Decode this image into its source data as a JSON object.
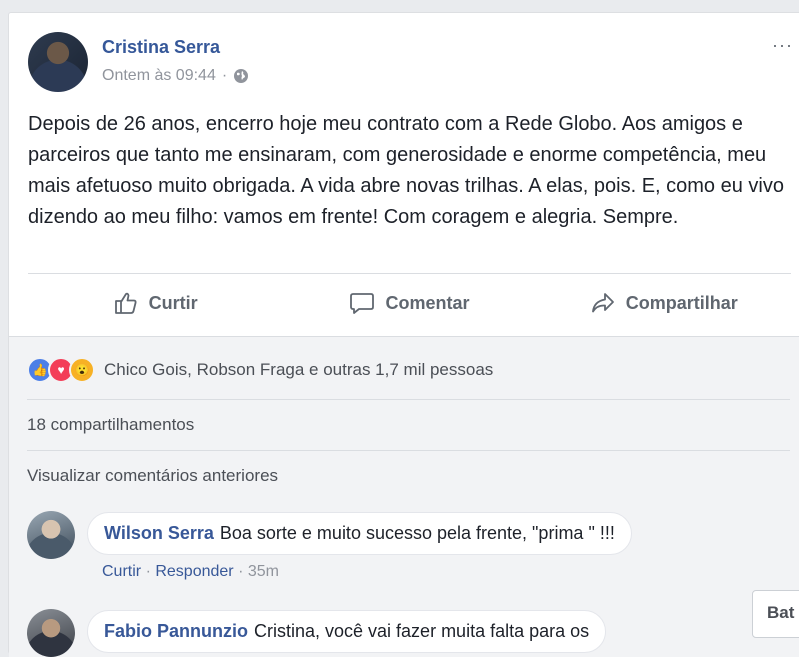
{
  "post": {
    "author": "Cristina Serra",
    "timestamp": "Ontem às 09:44",
    "separator": "·",
    "privacy_icon": "globe-icon",
    "more_label": "···",
    "text": "Depois de 26 anos, encerro hoje meu contrato com a Rede Globo. Aos amigos e parceiros que tanto me ensinaram, com generosidade e enorme competência, meu mais afetuoso muito obrigada. A vida abre novas trilhas. A elas, pois. E, como eu vivo dizendo ao meu filho: vamos em frente! Com coragem e alegria. Sempre."
  },
  "actions": {
    "like_label": "Curtir",
    "comment_label": "Comentar",
    "share_label": "Compartilhar"
  },
  "reactions": {
    "summary": "Chico Gois, Robson Fraga e outras 1,7 mil pessoas",
    "types": [
      "like",
      "love",
      "wow"
    ]
  },
  "shares": "18 compartilhamentos",
  "view_previous": "Visualizar comentários anteriores",
  "comments": [
    {
      "name": "Wilson Serra",
      "text": "Boa sorte e muito sucesso pela frente, \"prima \" !!!",
      "like": "Curtir",
      "reply": "Responder",
      "sep": "·",
      "time": "35m"
    },
    {
      "name": "Fabio Pannunzio",
      "text": "Cristina, você vai fazer muita falta para os"
    }
  ],
  "chat_tab_label": "Bat",
  "colors": {
    "link_blue": "#365899",
    "meta_gray": "#90949c",
    "action_gray": "#606770",
    "background": "#e9ebee"
  }
}
